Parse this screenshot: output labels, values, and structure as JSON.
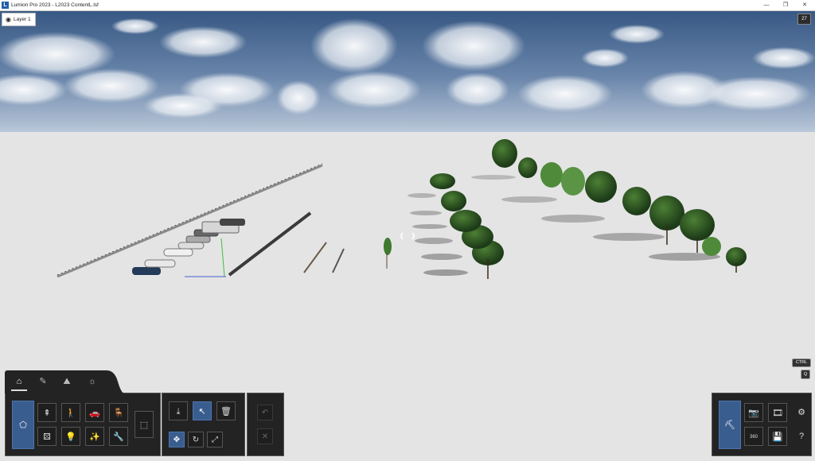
{
  "window": {
    "title": "Lumion Pro 2023 - L2023 ContentL.lsf",
    "logo_letter": "L",
    "minimize": "—",
    "restore": "❐",
    "close": "✕"
  },
  "layer": {
    "label": "Layer 1",
    "icon": "eye-icon"
  },
  "topright": {
    "label": "27"
  },
  "keys": {
    "ctrl": "CTRL",
    "q": "Q"
  },
  "tabs": [
    {
      "name": "home-tab",
      "glyph": "⌂",
      "active": true
    },
    {
      "name": "paint-tab",
      "glyph": "✎",
      "active": false
    },
    {
      "name": "landscape-tab",
      "glyph": "⛰",
      "active": false
    },
    {
      "name": "weather-tab",
      "glyph": "☼",
      "active": false
    }
  ],
  "object_library": {
    "main_button": "⬠",
    "row1": [
      "⇞",
      "🚶",
      "🚗",
      "🪑"
    ],
    "row2": [
      "⚄",
      "💡",
      "✨",
      "🔧"
    ],
    "select_area": "⬚"
  },
  "placement_tools": {
    "row1": [
      "⤓",
      "↖",
      "🗑"
    ],
    "row2": [
      "✥",
      "↻",
      "⤢"
    ]
  },
  "history": {
    "undo": "↶",
    "clear": "✕"
  },
  "modes": {
    "build": "⛏",
    "row1": [
      "📷",
      "🎞",
      "⚙"
    ],
    "row2": [
      "360",
      "💾",
      "?"
    ]
  },
  "colors": {
    "sky_top": "#3c5d8a",
    "sky_horizon": "#b9c7d8",
    "ground": "#e4e4e4",
    "tree_dark": "#1d3b18",
    "tree_light": "#4c7f34",
    "accent": "#3a5d8f"
  }
}
